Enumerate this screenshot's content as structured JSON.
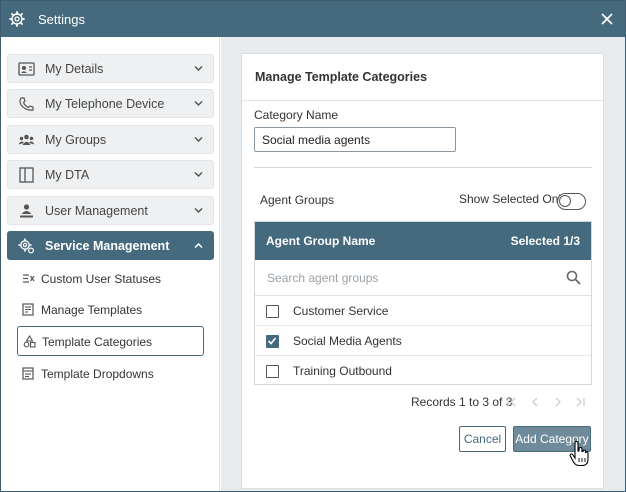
{
  "window": {
    "title": "Settings"
  },
  "sidebar": {
    "items": [
      {
        "label": "My Details",
        "icon": "contact-card-icon"
      },
      {
        "label": "My Telephone Device",
        "icon": "phone-icon"
      },
      {
        "label": "My Groups",
        "icon": "people-group-icon"
      },
      {
        "label": "My DTA",
        "icon": "dta-panel-icon"
      },
      {
        "label": "User Management",
        "icon": "user-management-icon"
      },
      {
        "label": "Service Management",
        "icon": "service-gear-icon",
        "active": true
      }
    ],
    "subitems": [
      {
        "label": "Custom User Statuses",
        "icon": "custom-status-icon"
      },
      {
        "label": "Manage Templates",
        "icon": "manage-templates-icon"
      },
      {
        "label": "Template Categories",
        "icon": "template-categories-icon",
        "selected": true
      },
      {
        "label": "Template Dropdowns",
        "icon": "template-dropdowns-icon"
      }
    ]
  },
  "panel": {
    "header": "Manage Template Categories",
    "category_name_label": "Category Name",
    "category_name_value": "Social media agents",
    "agent_groups_label": "Agent Groups",
    "show_selected_label": "Show Selected Only",
    "show_selected_on": false,
    "grid": {
      "col_name": "Agent Group Name",
      "col_selected": "Selected 1/3",
      "search_placeholder": "Search agent groups",
      "rows": [
        {
          "label": "Customer Service",
          "checked": false
        },
        {
          "label": "Social Media Agents",
          "checked": true
        },
        {
          "label": "Training Outbound",
          "checked": false
        }
      ]
    },
    "records_text": "Records 1 to 3 of 3",
    "cancel_label": "Cancel",
    "add_label": "Add Category"
  },
  "colors": {
    "accent": "#456a7e",
    "content_bg": "#e8ebed",
    "add_button_bg": "#6f8a9a"
  }
}
